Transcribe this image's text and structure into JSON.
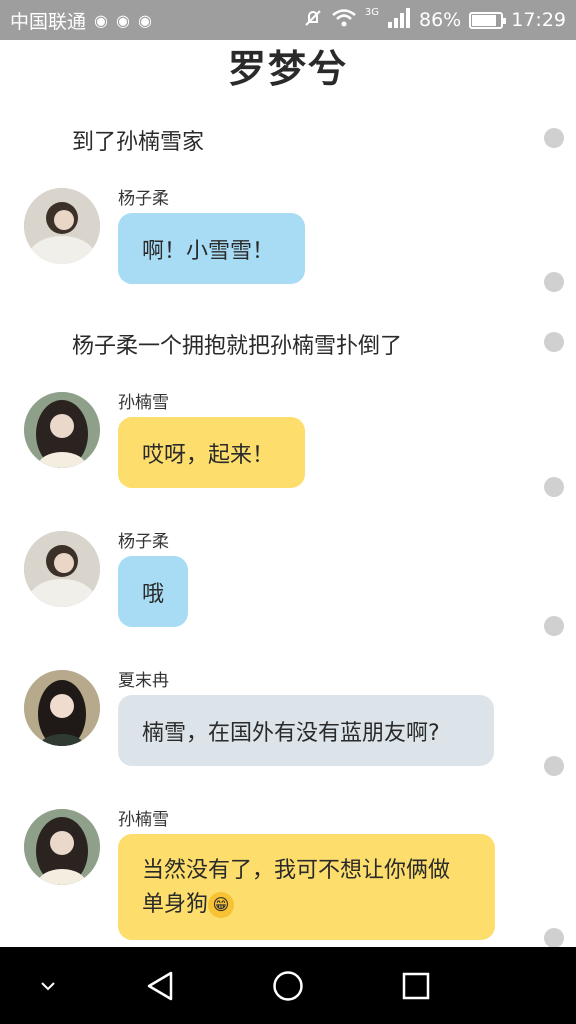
{
  "status_bar": {
    "carrier": "中国联通",
    "network": "3G",
    "battery": "86%",
    "battery_level": 0.86,
    "time": "17:29",
    "icons": [
      "weibo-icon",
      "app-icon",
      "app-icon",
      "mute-icon",
      "wifi-icon",
      "signal-icon",
      "battery-icon"
    ]
  },
  "page": {
    "title": "罗梦兮"
  },
  "narrations": [
    "到了孙楠雪家",
    "杨子柔一个拥抱就把孙楠雪扑倒了"
  ],
  "messages": [
    {
      "sender": "杨子柔",
      "text": "啊！小雪雪！",
      "bubble_color": "#a8dcf5"
    },
    {
      "sender": "孙楠雪",
      "text": "哎呀，起来！",
      "bubble_color": "#fdde6c"
    },
    {
      "sender": "杨子柔",
      "text": "哦",
      "bubble_color": "#a8dcf5"
    },
    {
      "sender": "夏末冉",
      "text": "楠雪，在国外有没有蓝朋友啊?",
      "bubble_color": "#dde4e9"
    },
    {
      "sender": "孙楠雪",
      "text": "当然没有了，我可不想让你俩做单身狗",
      "emoji": "😁",
      "bubble_color": "#fdde6c"
    }
  ],
  "nav_bar": {
    "icons": [
      "chevron-down-icon",
      "back-icon",
      "home-icon",
      "recents-icon"
    ]
  }
}
